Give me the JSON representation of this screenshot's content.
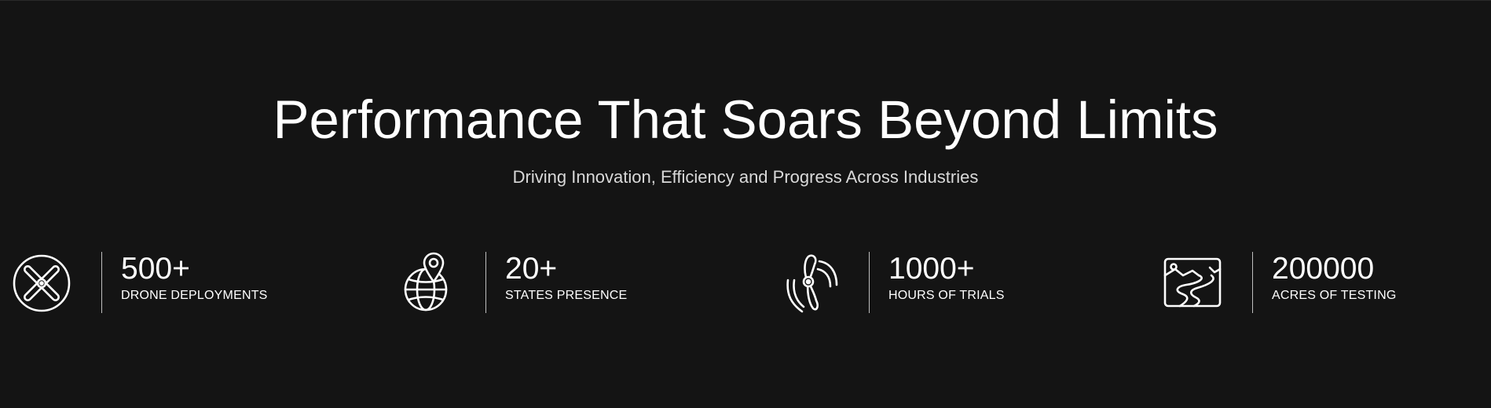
{
  "hero": {
    "title": "Performance That Soars Beyond Limits",
    "subtitle": "Driving Innovation, Efficiency and Progress Across Industries"
  },
  "stats": [
    {
      "icon": "propeller-icon",
      "value": "500+",
      "label": "DRONE DEPLOYMENTS"
    },
    {
      "icon": "globe-location-pin-icon",
      "value": "20+",
      "label": "STATES PRESENCE"
    },
    {
      "icon": "rotor-signal-icon",
      "value": "1000+",
      "label": "HOURS OF TRIALS"
    },
    {
      "icon": "landscape-map-icon",
      "value": "200000",
      "label": "ACRES OF TESTING"
    }
  ],
  "colors": {
    "background": "#141414",
    "text": "#ffffff",
    "subtitle": "#d9d9d9",
    "divider": "#bfbfbf"
  }
}
